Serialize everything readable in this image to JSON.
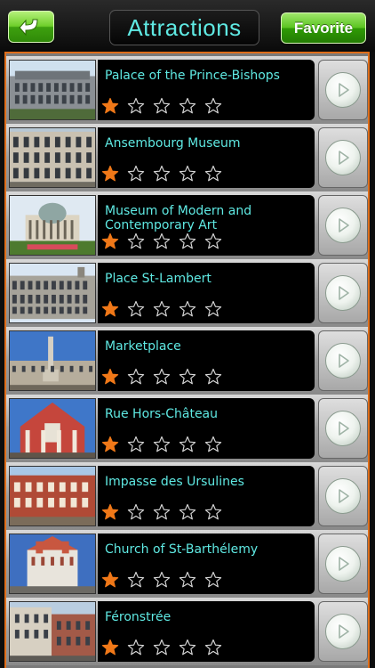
{
  "header": {
    "back_icon": "back-arrow-icon",
    "title": "Attractions",
    "favorite_label": "Favorite"
  },
  "colors": {
    "accent_cyan": "#5fe9e3",
    "star_filled": "#f07818",
    "list_border": "#e06e1a"
  },
  "attractions": [
    {
      "name": "Palace of the Prince-Bishops",
      "rating": 1
    },
    {
      "name": "Ansembourg Museum",
      "rating": 1
    },
    {
      "name": "Museum of Modern and Contemporary Art",
      "rating": 1
    },
    {
      "name": "Place St-Lambert",
      "rating": 1
    },
    {
      "name": "Marketplace",
      "rating": 1
    },
    {
      "name": "Rue Hors-Château",
      "rating": 1
    },
    {
      "name": "Impasse des Ursulines",
      "rating": 1
    },
    {
      "name": "Church of St-Barthélemy",
      "rating": 1
    },
    {
      "name": "Féronstrée",
      "rating": 1
    }
  ],
  "max_rating": 5,
  "row_icons": {
    "thumbnail": "attraction-photo",
    "detail": "chevron-right-icon"
  }
}
